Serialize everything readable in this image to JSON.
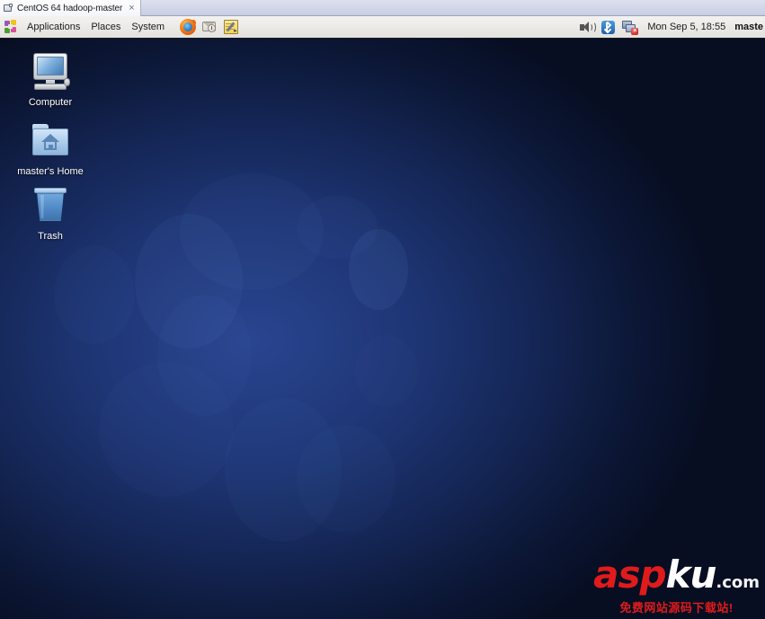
{
  "vmware": {
    "tab": {
      "icon": "vm-screen-icon",
      "title": "CentOS 64 hadoop-master",
      "close": "×"
    }
  },
  "panel": {
    "logo_icon": "centos-logo-icon",
    "menus": [
      {
        "label": "Applications"
      },
      {
        "label": "Places"
      },
      {
        "label": "System"
      }
    ],
    "launchers": [
      {
        "name": "firefox-icon",
        "title": "Firefox Web Browser"
      },
      {
        "name": "evolution-icon",
        "title": "Evolution Mail"
      },
      {
        "name": "gedit-icon",
        "title": "Text Editor"
      }
    ],
    "tray": [
      {
        "name": "volume-icon"
      },
      {
        "name": "bluetooth-icon"
      },
      {
        "name": "network-disconnected-icon",
        "badge": "×"
      }
    ],
    "clock": "Mon Sep  5, 18:55",
    "username": "maste"
  },
  "desktop": {
    "icons": [
      {
        "name": "computer",
        "label": "Computer",
        "icon": "computer-monitor-icon"
      },
      {
        "name": "home",
        "label": "master's Home",
        "icon": "home-folder-icon"
      },
      {
        "name": "trash",
        "label": "Trash",
        "icon": "trash-bin-icon"
      }
    ]
  },
  "watermark": {
    "asp": "asp",
    "ku": "ku",
    "com": ".com",
    "subtitle": "免费网站源码下载站!"
  },
  "colors": {
    "panel_bg": "#ecebe8",
    "desktop_blue": "#1d3472",
    "accent_red": "#e01b1b",
    "tab_bar": "#d1d6e7"
  }
}
